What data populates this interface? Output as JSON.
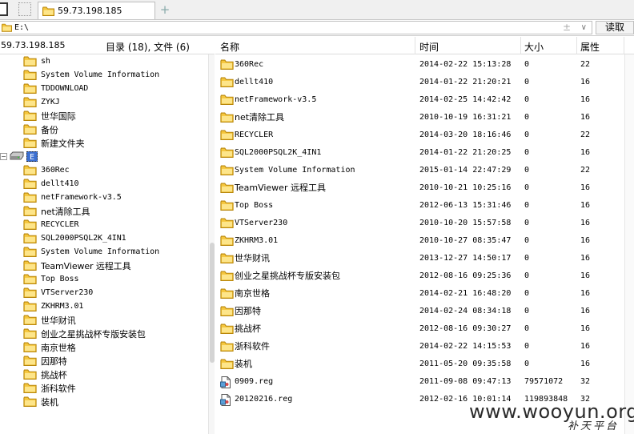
{
  "tab": {
    "title": "59.73.198.185",
    "add_label": "+"
  },
  "address": {
    "path": "E:\\",
    "plus_label": "±",
    "dropdown_label": "∨",
    "read_button": "读取"
  },
  "left_panel": {
    "host": "59.73.198.185",
    "summary": "目录 (18), 文件 (6)",
    "tree": [
      {
        "label": "sh",
        "level": 1
      },
      {
        "label": "System Volume Information",
        "level": 1
      },
      {
        "label": "TDDOWNLOAD",
        "level": 1
      },
      {
        "label": "ZYKJ",
        "level": 1
      },
      {
        "label": "世华国际",
        "level": 1
      },
      {
        "label": "备份",
        "level": 1
      },
      {
        "label": "新建文件夹",
        "level": 1
      },
      {
        "label": "E",
        "level": 0,
        "drive": true,
        "toggle": "−"
      },
      {
        "label": "360Rec",
        "level": 1
      },
      {
        "label": "dellt410",
        "level": 1
      },
      {
        "label": "netFramework-v3.5",
        "level": 1
      },
      {
        "label": "net清除工具",
        "level": 1
      },
      {
        "label": "RECYCLER",
        "level": 1
      },
      {
        "label": "SQL2000PSQL2K_4IN1",
        "level": 1
      },
      {
        "label": "System Volume Information",
        "level": 1
      },
      {
        "label": "TeamViewer 远程工具",
        "level": 1
      },
      {
        "label": "Top Boss",
        "level": 1
      },
      {
        "label": "VTServer230",
        "level": 1
      },
      {
        "label": "ZKHRM3.01",
        "level": 1
      },
      {
        "label": "世华财讯",
        "level": 1
      },
      {
        "label": "创业之星挑战杯专版安装包",
        "level": 1
      },
      {
        "label": "南京世格",
        "level": 1
      },
      {
        "label": "因那特",
        "level": 1
      },
      {
        "label": "挑战杯",
        "level": 1
      },
      {
        "label": "浙科软件",
        "level": 1
      },
      {
        "label": "装机",
        "level": 1
      }
    ]
  },
  "list": {
    "columns": {
      "name": "名称",
      "time": "时间",
      "size": "大小",
      "attr": "属性"
    },
    "rows": [
      {
        "type": "folder",
        "name": "360Rec",
        "time": "2014-02-22 15:13:28",
        "size": "0",
        "attr": "22"
      },
      {
        "type": "folder",
        "name": "dellt410",
        "time": "2014-01-22 21:20:21",
        "size": "0",
        "attr": "16"
      },
      {
        "type": "folder",
        "name": "netFramework-v3.5",
        "time": "2014-02-25 14:42:42",
        "size": "0",
        "attr": "16"
      },
      {
        "type": "folder",
        "name": "net清除工具",
        "time": "2010-10-19 16:31:21",
        "size": "0",
        "attr": "16"
      },
      {
        "type": "folder",
        "name": "RECYCLER",
        "time": "2014-03-20 18:16:46",
        "size": "0",
        "attr": "22"
      },
      {
        "type": "folder",
        "name": "SQL2000PSQL2K_4IN1",
        "time": "2014-01-22 21:20:25",
        "size": "0",
        "attr": "16"
      },
      {
        "type": "folder",
        "name": "System Volume Information",
        "time": "2015-01-14 22:47:29",
        "size": "0",
        "attr": "22"
      },
      {
        "type": "folder",
        "name": "TeamViewer 远程工具",
        "time": "2010-10-21 10:25:16",
        "size": "0",
        "attr": "16"
      },
      {
        "type": "folder",
        "name": "Top Boss",
        "time": "2012-06-13 15:31:46",
        "size": "0",
        "attr": "16"
      },
      {
        "type": "folder",
        "name": "VTServer230",
        "time": "2010-10-20 15:57:58",
        "size": "0",
        "attr": "16"
      },
      {
        "type": "folder",
        "name": "ZKHRM3.01",
        "time": "2010-10-27 08:35:47",
        "size": "0",
        "attr": "16"
      },
      {
        "type": "folder",
        "name": "世华财讯",
        "time": "2013-12-27 14:50:17",
        "size": "0",
        "attr": "16"
      },
      {
        "type": "folder",
        "name": "创业之星挑战杯专版安装包",
        "time": "2012-08-16 09:25:36",
        "size": "0",
        "attr": "16"
      },
      {
        "type": "folder",
        "name": "南京世格",
        "time": "2014-02-21 16:48:20",
        "size": "0",
        "attr": "16"
      },
      {
        "type": "folder",
        "name": "因那特",
        "time": "2014-02-24 08:34:18",
        "size": "0",
        "attr": "16"
      },
      {
        "type": "folder",
        "name": "挑战杯",
        "time": "2012-08-16 09:30:27",
        "size": "0",
        "attr": "16"
      },
      {
        "type": "folder",
        "name": "浙科软件",
        "time": "2014-02-22 14:15:53",
        "size": "0",
        "attr": "16"
      },
      {
        "type": "folder",
        "name": "装机",
        "time": "2011-05-20 09:35:58",
        "size": "0",
        "attr": "16"
      },
      {
        "type": "file",
        "name": "0909.reg",
        "time": "2011-09-08 09:47:13",
        "size": "79571072",
        "attr": "32"
      },
      {
        "type": "file",
        "name": "20120216.reg",
        "time": "2012-02-16 10:01:14",
        "size": "119893848",
        "attr": "32"
      }
    ]
  },
  "watermark": {
    "text": "www.wooyun.org",
    "sub": "补天平台"
  },
  "colors": {
    "folder": "#f5c63c",
    "folder_outline": "#b8860b",
    "selection": "#3b6fd1"
  }
}
